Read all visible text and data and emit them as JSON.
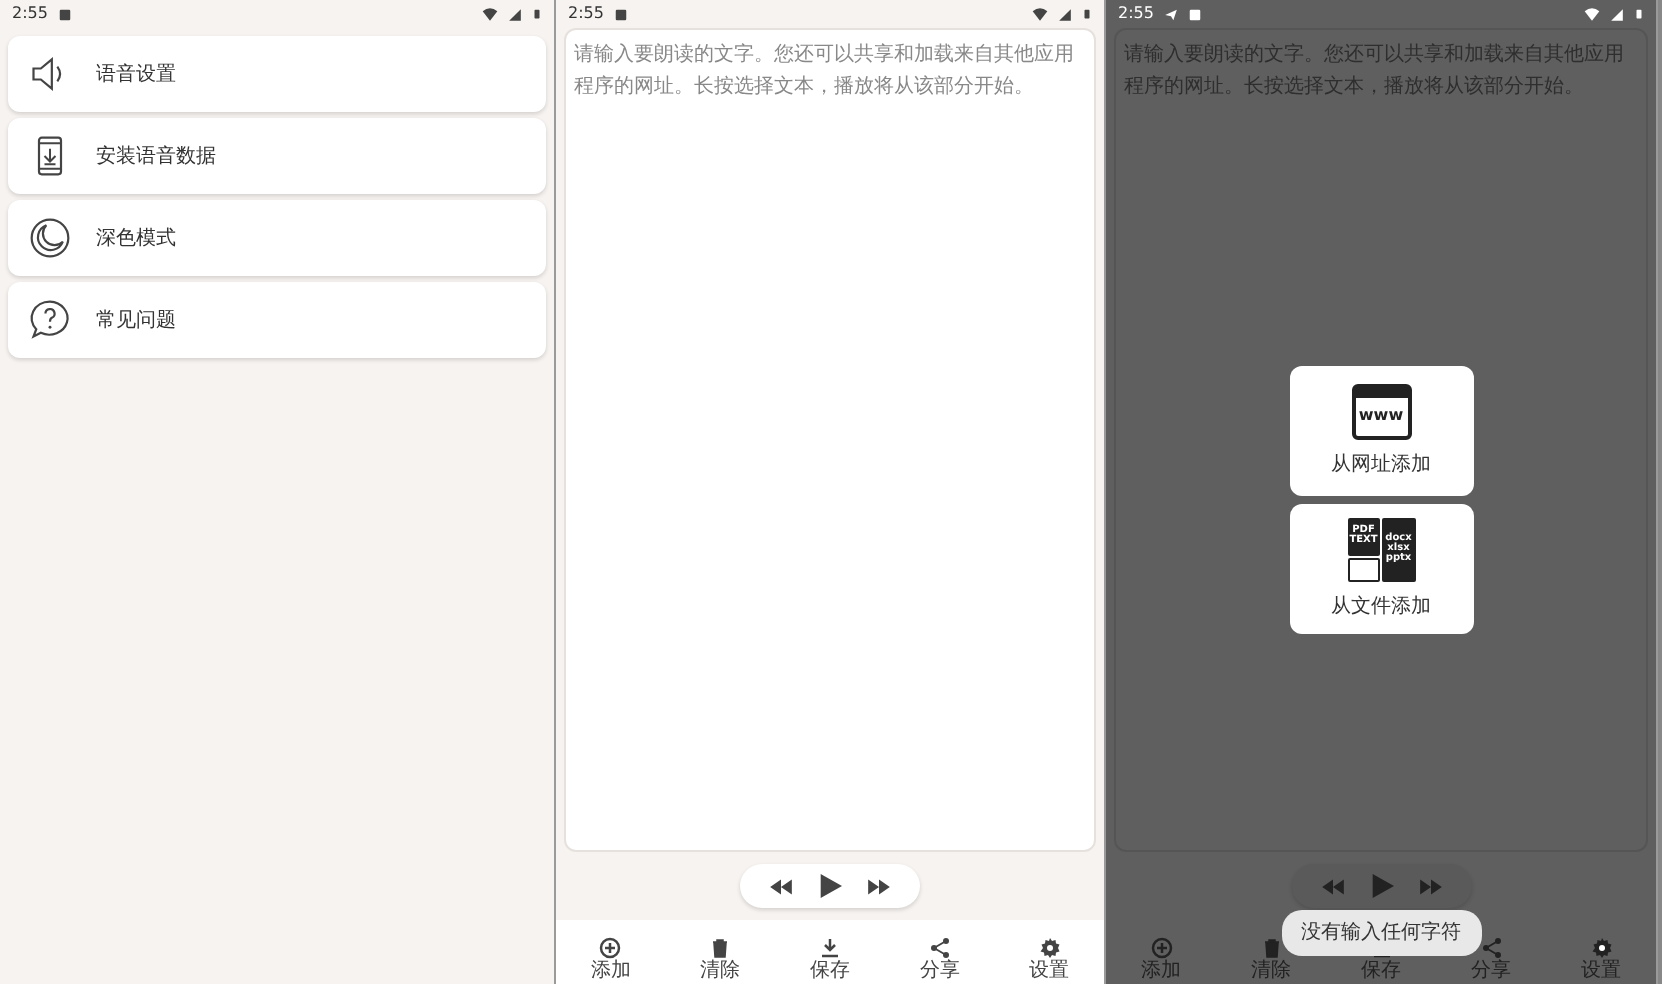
{
  "screens": [
    {
      "kind": "menu",
      "dimmed": false,
      "status_bar": {
        "time": "2:55",
        "extra_notification": false
      },
      "items": [
        {
          "label": "语音设置"
        },
        {
          "label": "安装语音数据"
        },
        {
          "label": "深色模式"
        },
        {
          "label": "常见问题"
        }
      ]
    },
    {
      "kind": "editor",
      "dimmed": false,
      "status_bar": {
        "time": "2:55",
        "extra_notification": false
      },
      "placeholder": "请输入要朗读的文字。您还可以共享和加载来自其他应用程序的网址。长按选择文本，播放将从该部分开始。",
      "toolbar": [
        {
          "label": "添加"
        },
        {
          "label": "清除"
        },
        {
          "label": "保存"
        },
        {
          "label": "分享"
        },
        {
          "label": "设置"
        }
      ]
    },
    {
      "kind": "editor",
      "dimmed": true,
      "status_bar": {
        "time": "2:55",
        "extra_notification": true
      },
      "placeholder": "请输入要朗读的文字。您还可以共享和加载来自其他应用程序的网址。长按选择文本，播放将从该部分开始。",
      "toolbar": [
        {
          "label": "添加"
        },
        {
          "label": "清除"
        },
        {
          "label": "保存"
        },
        {
          "label": "分享"
        },
        {
          "label": "设置"
        }
      ],
      "popup": [
        {
          "kind": "web",
          "label": "从网址添加",
          "icon_texts": [
            "www"
          ]
        },
        {
          "kind": "file",
          "label": "从文件添加",
          "icon_texts": [
            "PDF",
            "TEXT",
            "docx",
            "xlsx",
            "pptx"
          ]
        }
      ],
      "toast": "没有输入任何字符"
    }
  ]
}
